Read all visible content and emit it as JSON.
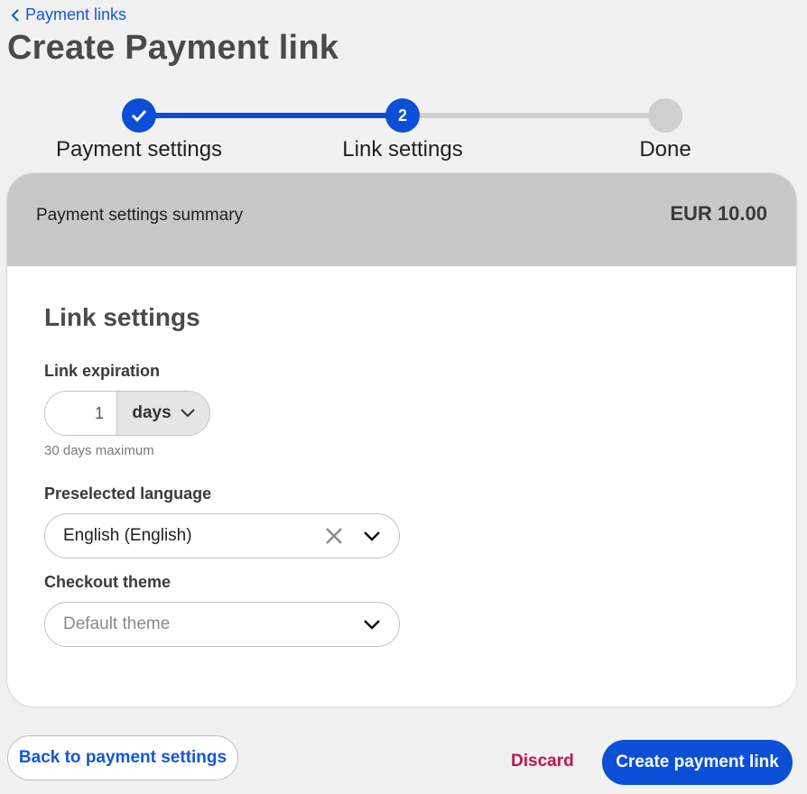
{
  "breadcrumb": {
    "label": "Payment links"
  },
  "page_title": "Create Payment link",
  "stepper": {
    "steps": [
      {
        "label": "Payment settings",
        "state": "completed",
        "number": ""
      },
      {
        "label": "Link settings",
        "state": "current",
        "number": "2"
      },
      {
        "label": "Done",
        "state": "upcoming",
        "number": ""
      }
    ]
  },
  "summary": {
    "title": "Payment settings summary",
    "amount": "EUR 10.00"
  },
  "link_settings": {
    "title": "Link settings",
    "expiration": {
      "label": "Link expiration",
      "value": "1",
      "unit": "days",
      "hint": "30 days maximum"
    },
    "language": {
      "label": "Preselected language",
      "value": "English (English)"
    },
    "theme": {
      "label": "Checkout theme",
      "placeholder": "Default theme"
    }
  },
  "footer": {
    "back_label": "Back to payment settings",
    "discard_label": "Discard",
    "create_label": "Create payment link"
  },
  "colors": {
    "primary": "#0a4fd6",
    "danger": "#c8124e",
    "step_inactive": "#cfcfcf",
    "summary_bg": "#c8c8c8"
  }
}
